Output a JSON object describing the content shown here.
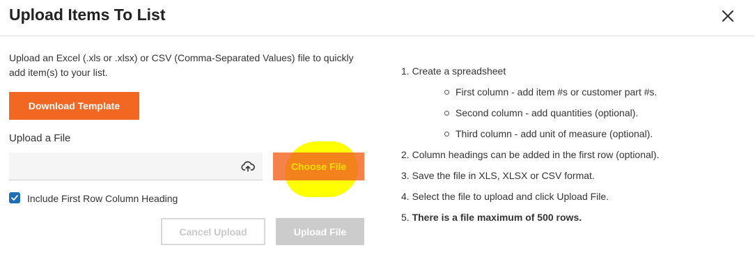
{
  "modal": {
    "title": "Upload Items To List"
  },
  "intro": {
    "text": "Upload an Excel (.xls or .xlsx) or CSV (Comma-Separated Values) file to quickly add item(s) to your list."
  },
  "buttons": {
    "download_template": "Download Template",
    "choose_file": "Choose File",
    "cancel_upload": "Cancel Upload",
    "upload_file": "Upload File"
  },
  "upload": {
    "label": "Upload a File",
    "value": ""
  },
  "checkbox": {
    "label": "Include First Row Column Heading",
    "checked": true
  },
  "instructions": {
    "steps": [
      {
        "num": "1.",
        "text": "Create a spreadsheet"
      },
      {
        "num": "2.",
        "text": "Column headings can be added in the first row (optional)."
      },
      {
        "num": "3.",
        "text": "Save the file in XLS, XLSX or CSV format."
      },
      {
        "num": "4.",
        "text": "Select the file to upload and click Upload File."
      },
      {
        "num": "5.",
        "text": "There is a file maximum of 500 rows."
      }
    ],
    "subitems": [
      "First column - add item #s or customer part #s.",
      "Second column - add quantities (optional).",
      "Third column - add unit of measure (optional)."
    ]
  },
  "colors": {
    "accent": "#f26722",
    "checkbox": "#1f6db5",
    "highlight": "#ffff00",
    "disabled": "#cccccc"
  },
  "icons": {
    "close": "close-icon",
    "upload": "cloud-upload-icon",
    "check": "checkmark-icon"
  }
}
